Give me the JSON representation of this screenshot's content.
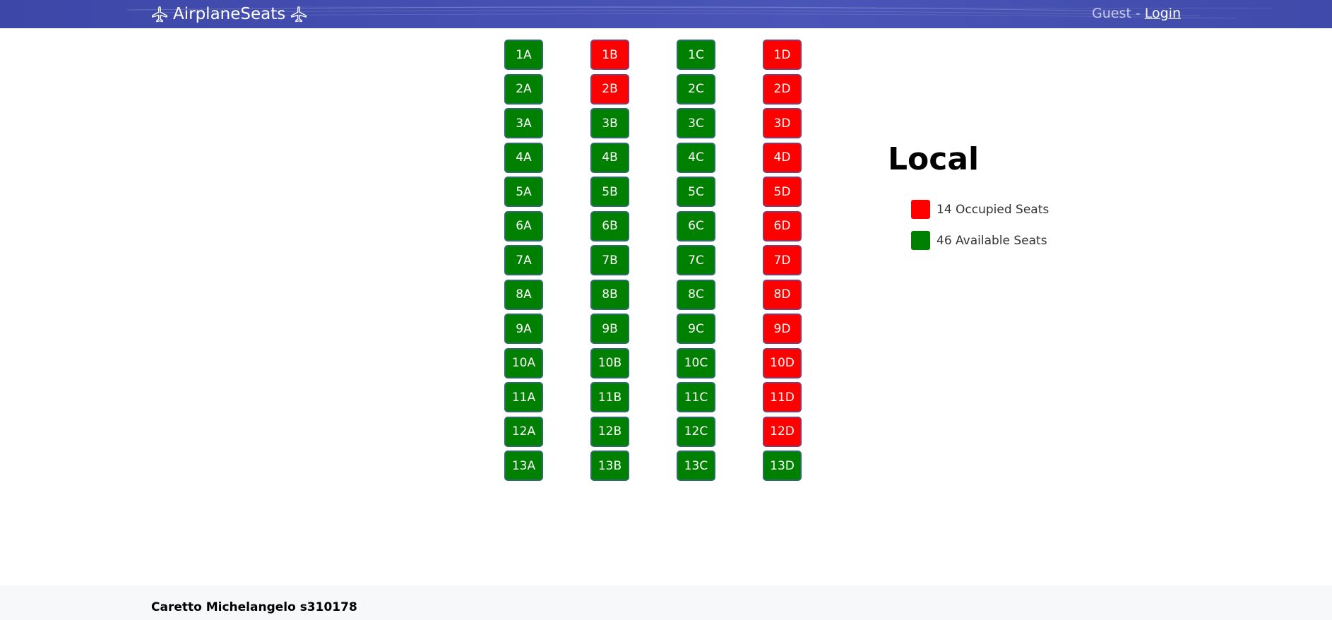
{
  "navbar": {
    "brand_label": "AirplaneSeats",
    "brand_icon": "airplane-icon",
    "user_label": "Guest",
    "separator": " - ",
    "login_label": "Login",
    "background_color": "#4350b0"
  },
  "seats": {
    "columns": [
      "A",
      "B",
      "C",
      "D"
    ],
    "rows": 13,
    "occupied": [
      "1B",
      "1D",
      "2B",
      "2D",
      "3D",
      "4D",
      "5D",
      "6D",
      "7D",
      "8D",
      "9D",
      "10D",
      "11D",
      "12D"
    ],
    "colors": {
      "available": "#008000",
      "occupied": "#ff0000"
    }
  },
  "legend": {
    "title": "Local",
    "occupied_label": "14 Occupied Seats",
    "available_label": "46 Available Seats"
  },
  "footer": {
    "text": "Caretto Michelangelo s310178"
  }
}
